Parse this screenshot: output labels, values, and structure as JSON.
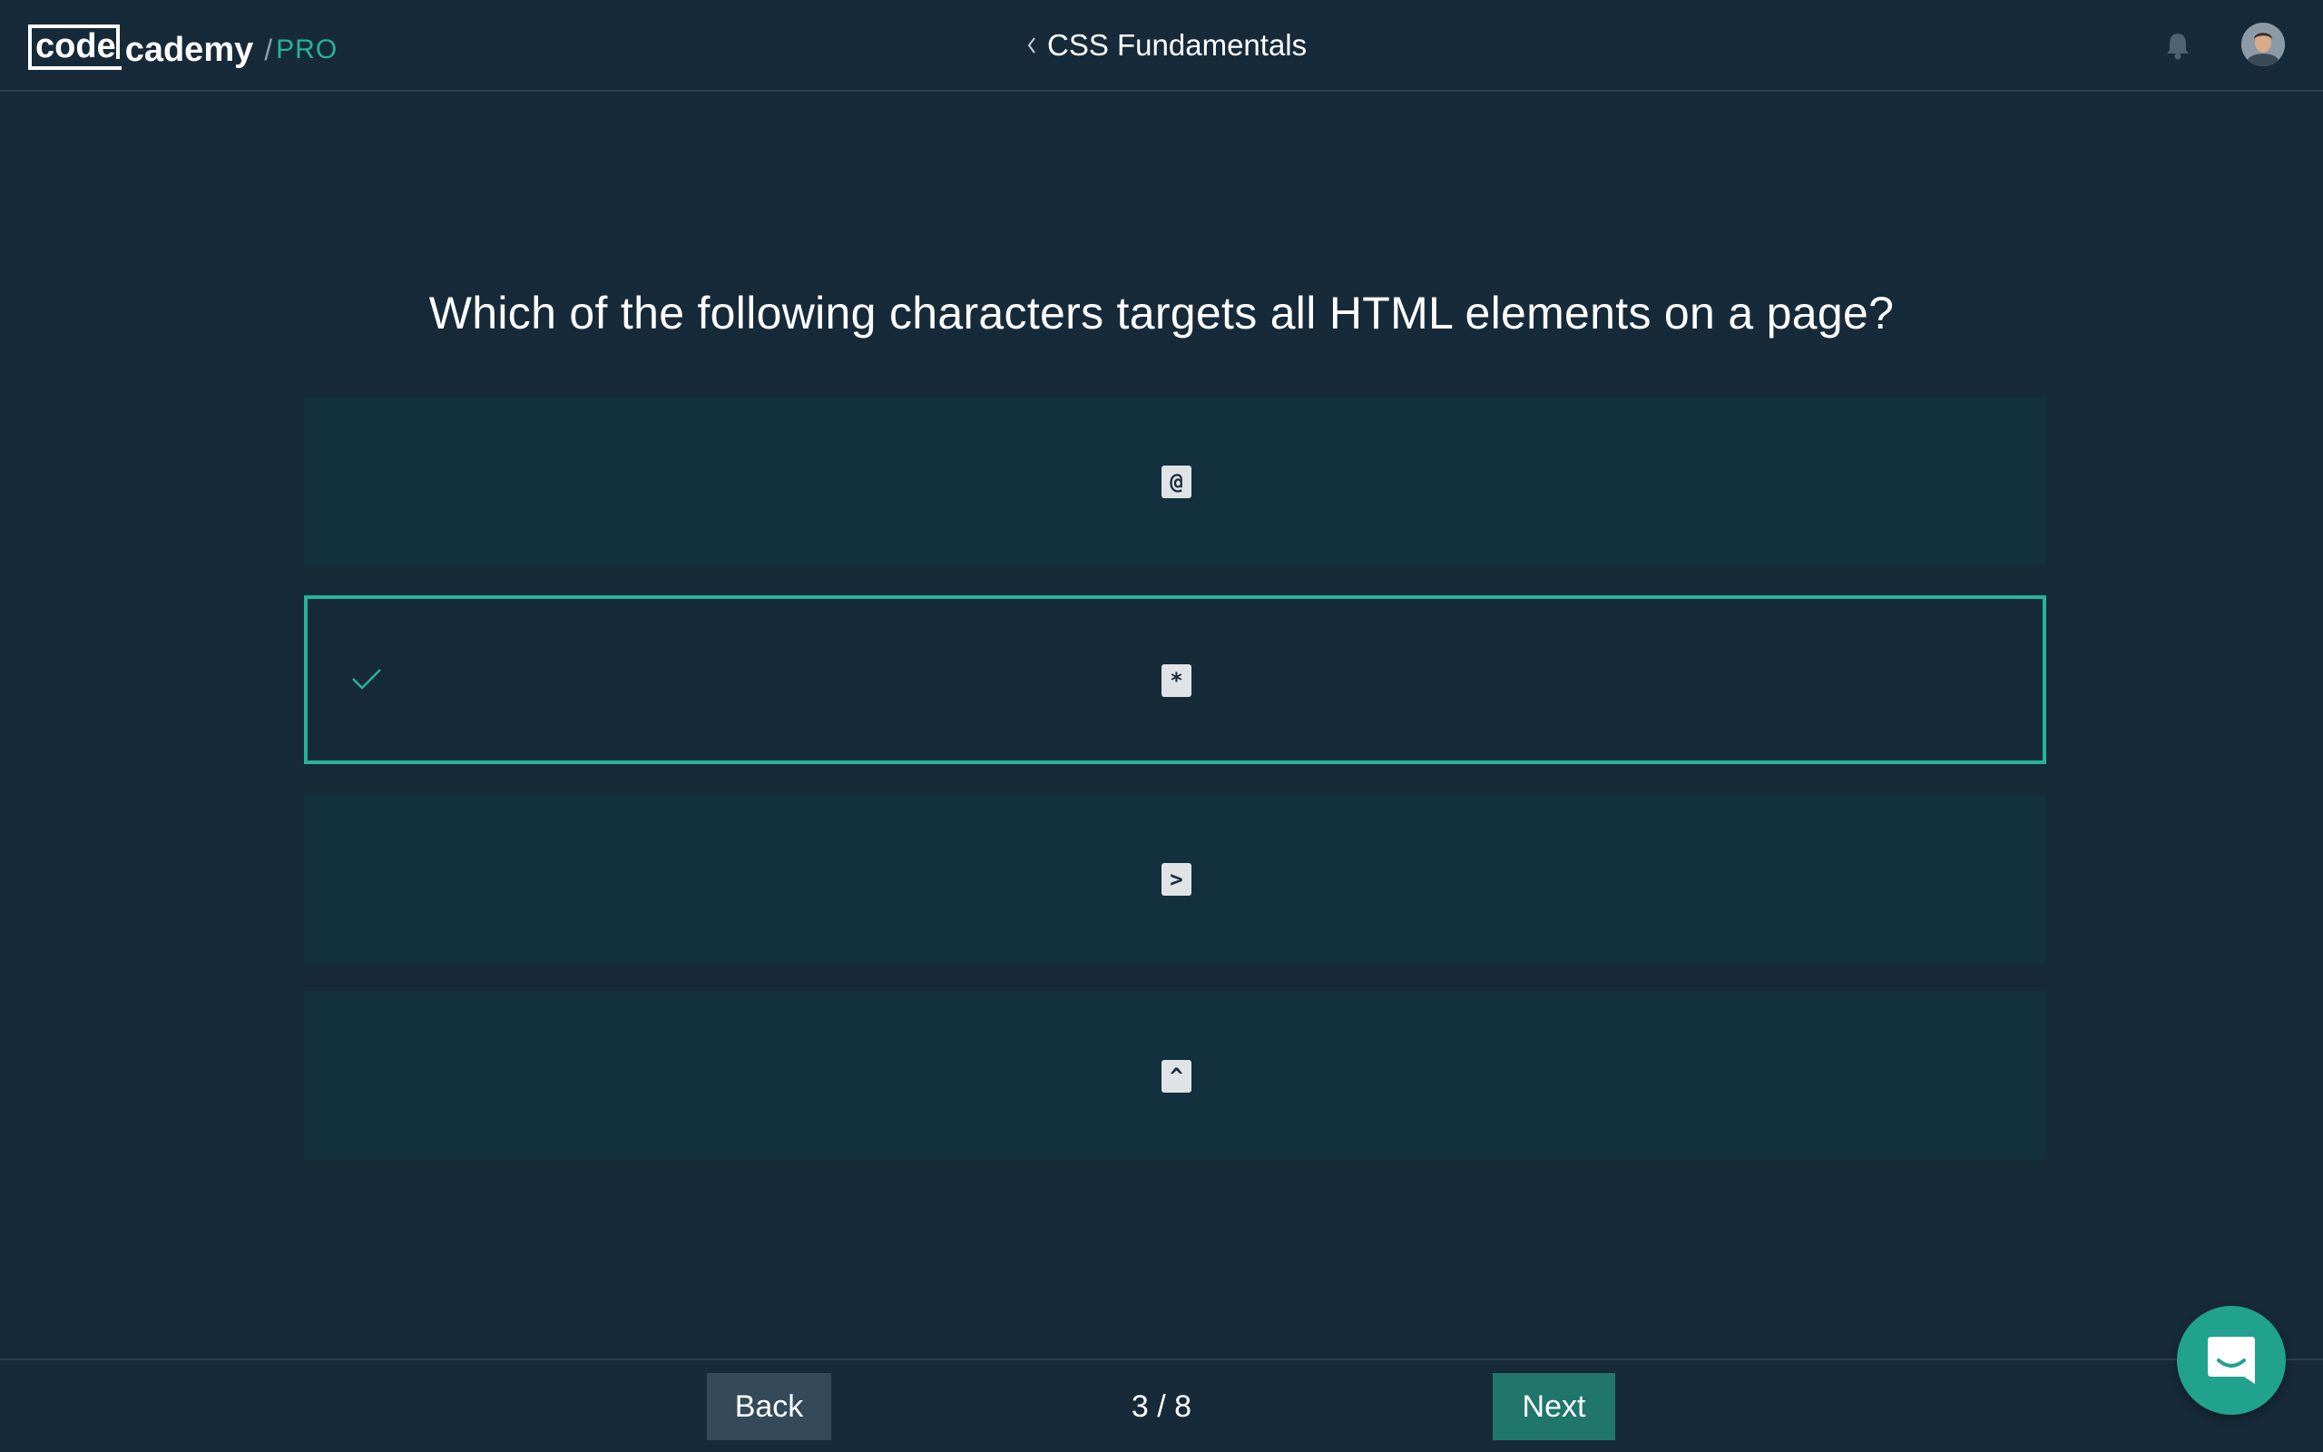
{
  "header": {
    "logo": {
      "code": "code",
      "cademy": "cademy",
      "slash": "/",
      "pro": "PRO"
    },
    "course_title": "CSS Fundamentals",
    "icons": {
      "back": "chevron-left-icon",
      "notifications": "bell-icon",
      "avatar": "user-avatar"
    }
  },
  "quiz": {
    "question": "Which of the following characters targets all HTML elements on a page?",
    "options": [
      {
        "label": "@",
        "selected": false
      },
      {
        "label": "*",
        "selected": true
      },
      {
        "label": ">",
        "selected": false
      },
      {
        "label": "^",
        "selected": false
      }
    ]
  },
  "footer": {
    "back_label": "Back",
    "progress": "3 / 8",
    "next_label": "Next"
  },
  "chat": {
    "icon": "chat-bubble-icon"
  },
  "colors": {
    "background": "#172a3a",
    "option_bg": "#12303e",
    "accent": "#26b39a",
    "next_button": "#20766b",
    "back_button": "#34495a"
  }
}
